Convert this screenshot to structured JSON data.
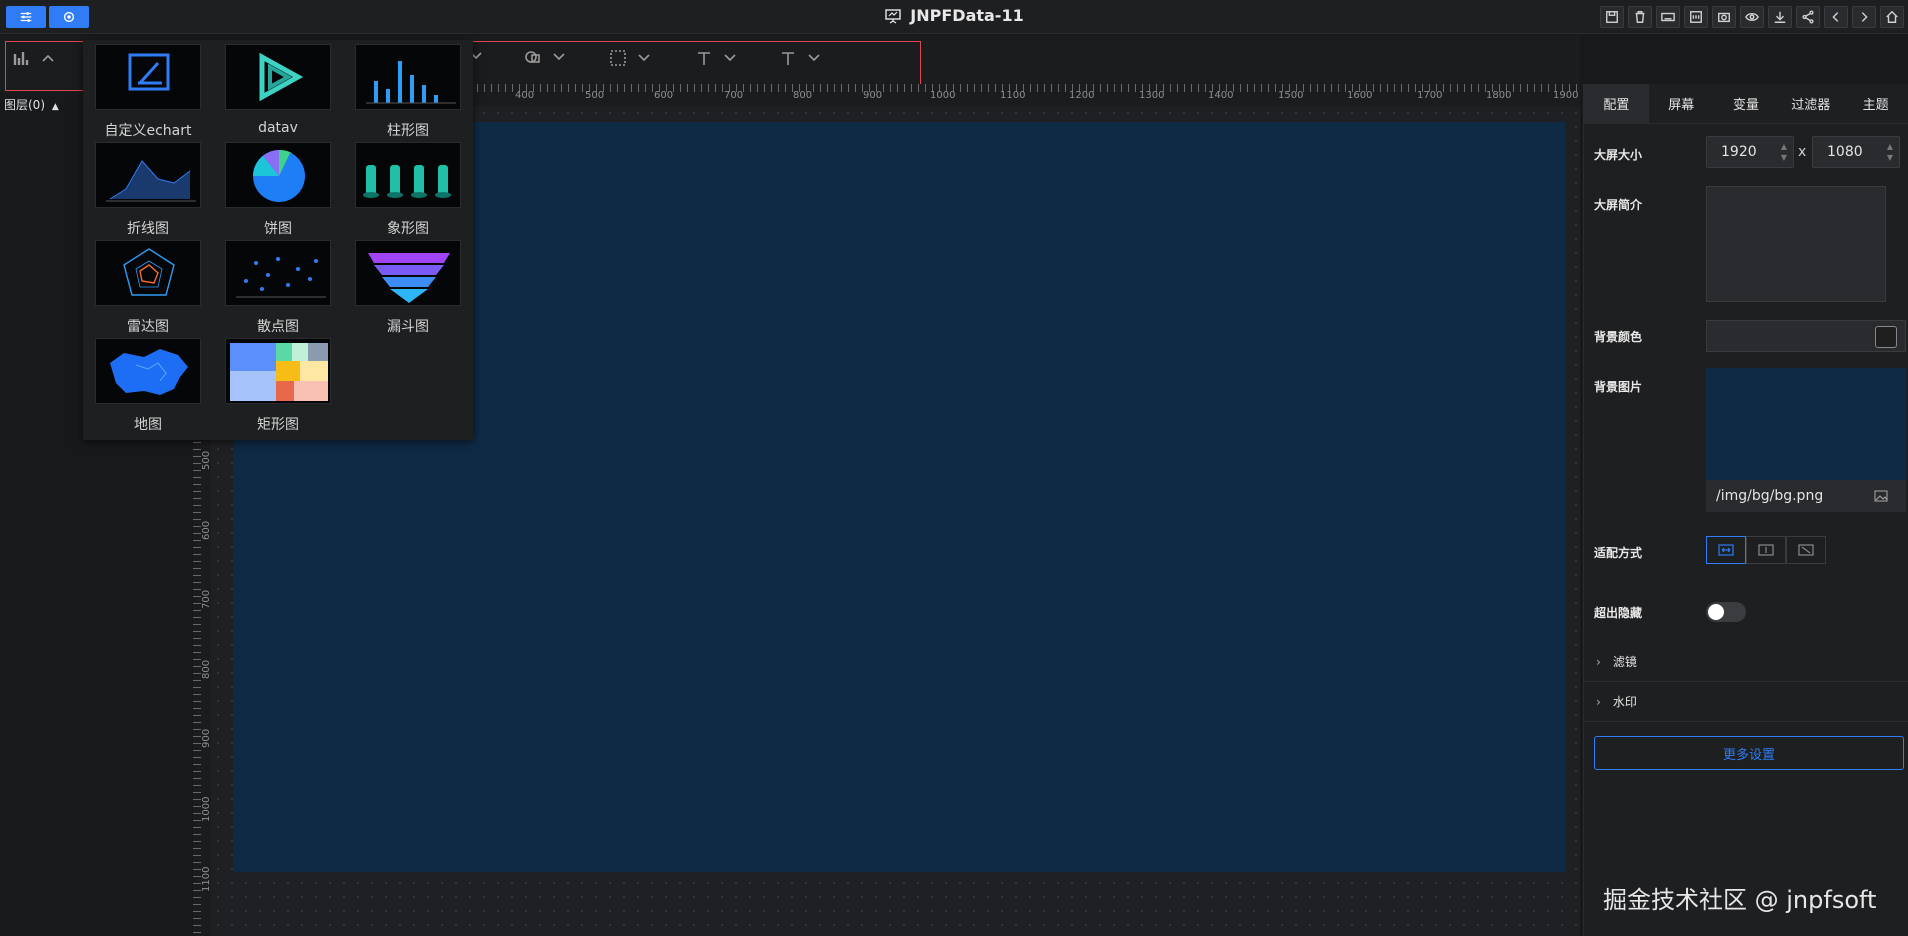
{
  "app": {
    "title": "JNPFData-11"
  },
  "layers": {
    "label": "图层(0)"
  },
  "toolbar_icons": [
    "save-icon",
    "delete-icon",
    "keyboard-icon",
    "code-icon",
    "camera-icon",
    "eye-icon",
    "download-icon",
    "share-icon",
    "back-icon",
    "forward-icon",
    "home-icon"
  ],
  "ruler": {
    "top": [
      "400",
      "500",
      "600",
      "700",
      "800",
      "900",
      "1000",
      "1100",
      "1200",
      "1300",
      "1400",
      "1500",
      "1600",
      "1700",
      "1800",
      "1900"
    ],
    "left": [
      "500",
      "600",
      "700",
      "800",
      "900",
      "1000",
      "1100"
    ]
  },
  "charts": [
    {
      "label": "自定义echart",
      "thumb": "custom"
    },
    {
      "label": "datav",
      "thumb": "datav"
    },
    {
      "label": "柱形图",
      "thumb": "bar"
    },
    {
      "label": "折线图",
      "thumb": "line"
    },
    {
      "label": "饼图",
      "thumb": "pie"
    },
    {
      "label": "象形图",
      "thumb": "pictorial"
    },
    {
      "label": "雷达图",
      "thumb": "radar"
    },
    {
      "label": "散点图",
      "thumb": "scatter"
    },
    {
      "label": "漏斗图",
      "thumb": "funnel"
    },
    {
      "label": "地图",
      "thumb": "map"
    },
    {
      "label": "矩形图",
      "thumb": "treemap"
    }
  ],
  "panel": {
    "tabs": [
      "配置",
      "屏幕",
      "变量",
      "过滤器",
      "主题"
    ],
    "size_label": "大屏大小",
    "width": "1920",
    "height": "1080",
    "x": "x",
    "intro_label": "大屏简介",
    "bg_color_label": "背景颜色",
    "bg_image_label": "背景图片",
    "bg_image_path": "/img/bg/bg.png",
    "fit_label": "适配方式",
    "overflow_label": "超出隐藏",
    "filter_label": "滤镜",
    "watermark_label": "水印",
    "more_settings": "更多设置"
  },
  "watermark": "掘金技术社区 @ jnpfsoft",
  "colors": {
    "accent": "#2f7cf6",
    "screen_bg": "#0f2a45"
  }
}
